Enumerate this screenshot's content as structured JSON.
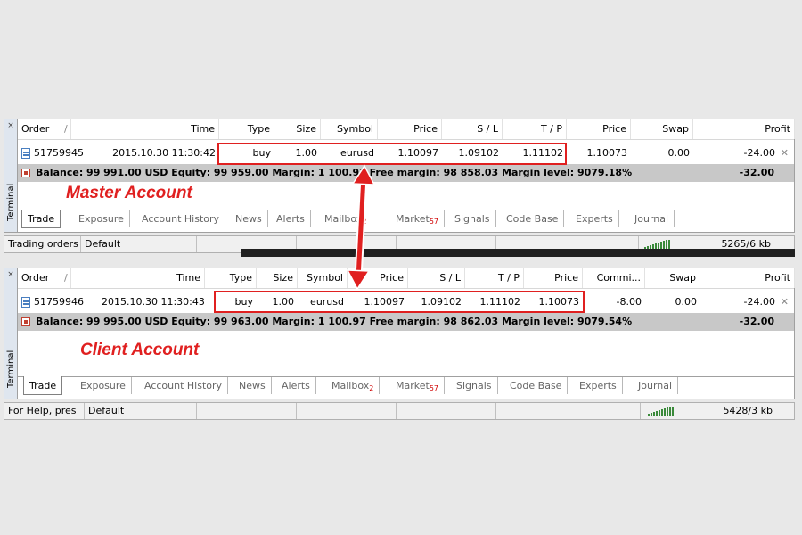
{
  "terminal_label": "Terminal",
  "master": {
    "annotation": "Master Account",
    "columns": [
      "Order",
      "/",
      "Time",
      "Type",
      "Size",
      "Symbol",
      "Price",
      "S / L",
      "T / P",
      "Price",
      "Swap",
      "Profit"
    ],
    "row": {
      "order": "51759945",
      "time": "2015.10.30 11:30:42",
      "type": "buy",
      "size": "1.00",
      "symbol": "eurusd",
      "price": "1.10097",
      "sl": "1.09102",
      "tp": "1.11102",
      "cur_price": "1.10073",
      "swap": "0.00",
      "profit": "-24.00"
    },
    "balance": "Balance: 99 991.00 USD  Equity: 99 959.00  Margin: 1 100.97  Free margin: 98 858.03  Margin level: 9079.18%",
    "balance_profit": "-32.00",
    "tabs": [
      {
        "label": "Trade",
        "badge": ""
      },
      {
        "label": "Exposure",
        "badge": ""
      },
      {
        "label": "Account History",
        "badge": ""
      },
      {
        "label": "News",
        "badge": ""
      },
      {
        "label": "Alerts",
        "badge": ""
      },
      {
        "label": "Mailbox",
        "badge": "2"
      },
      {
        "label": "Market",
        "badge": "57"
      },
      {
        "label": "Signals",
        "badge": ""
      },
      {
        "label": "Code Base",
        "badge": ""
      },
      {
        "label": "Experts",
        "badge": ""
      },
      {
        "label": "Journal",
        "badge": ""
      }
    ],
    "status": {
      "left": "Trading orders",
      "profile": "Default",
      "traffic": "5265/6 kb"
    }
  },
  "client": {
    "annotation": "Client Account",
    "columns": [
      "Order",
      "/",
      "Time",
      "Type",
      "Size",
      "Symbol",
      "Price",
      "S / L",
      "T / P",
      "Price",
      "Commi...",
      "Swap",
      "Profit"
    ],
    "row": {
      "order": "51759946",
      "time": "2015.10.30 11:30:43",
      "type": "buy",
      "size": "1.00",
      "symbol": "eurusd",
      "price": "1.10097",
      "sl": "1.09102",
      "tp": "1.11102",
      "cur_price": "1.10073",
      "commission": "-8.00",
      "swap": "0.00",
      "profit": "-24.00"
    },
    "balance": "Balance: 99 995.00 USD  Equity: 99 963.00  Margin: 1 100.97  Free margin: 98 862.03  Margin level: 9079.54%",
    "balance_profit": "-32.00",
    "tabs": [
      {
        "label": "Trade",
        "badge": ""
      },
      {
        "label": "Exposure",
        "badge": ""
      },
      {
        "label": "Account History",
        "badge": ""
      },
      {
        "label": "News",
        "badge": ""
      },
      {
        "label": "Alerts",
        "badge": ""
      },
      {
        "label": "Mailbox",
        "badge": "2"
      },
      {
        "label": "Market",
        "badge": "57"
      },
      {
        "label": "Signals",
        "badge": ""
      },
      {
        "label": "Code Base",
        "badge": ""
      },
      {
        "label": "Experts",
        "badge": ""
      },
      {
        "label": "Journal",
        "badge": ""
      }
    ],
    "status": {
      "left": "For Help, pres",
      "profile": "Default",
      "traffic": "5428/3 kb"
    }
  },
  "colors": {
    "annotation_red": "#e02020",
    "balance_bg": "#c8c8c8"
  }
}
